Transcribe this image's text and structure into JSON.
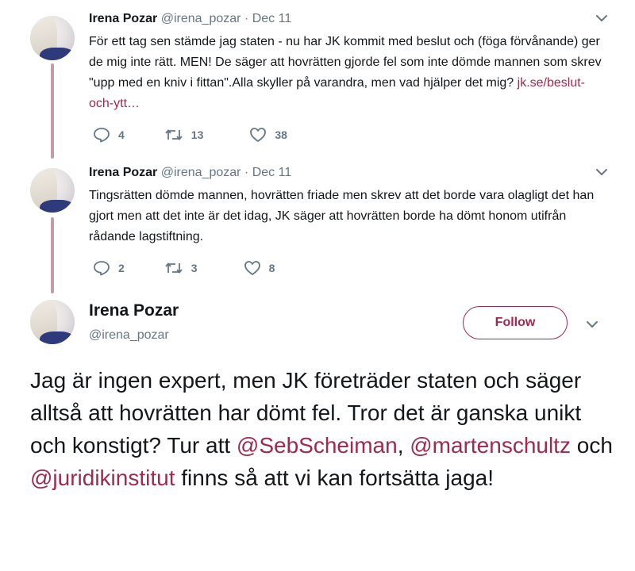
{
  "tweets": [
    {
      "name": "Irena Pozar",
      "handle": "@irena_pozar",
      "separator": "·",
      "date": "Dec 11",
      "text": "För ett tag sen stämde jag staten - nu har JK kommit med beslut och (föga förvånande) ger de mig inte rätt. MEN! De säger att hovrätten gjorde fel som inte dömde mannen som skrev \"upp med en kniv i fittan\".Alla skyller på varandra, men vad hjälper det mig? ",
      "link": "jk.se/beslut-och-ytt…",
      "replies": "4",
      "retweets": "13",
      "likes": "38"
    },
    {
      "name": "Irena Pozar",
      "handle": "@irena_pozar",
      "separator": "·",
      "date": "Dec 11",
      "text": "Tingsrätten dömde mannen, hovrätten friade men skrev att det borde vara olagligt det han gjort men att det inte är det idag, JK säger att hovrätten borde ha dömt honom utifrån rådande lagstiftning.",
      "replies": "2",
      "retweets": "3",
      "likes": "8"
    }
  ],
  "main": {
    "name": "Irena Pozar",
    "handle": "@irena_pozar",
    "follow_label": "Follow",
    "text_parts": [
      "Jag är ingen expert, men JK företräder staten och säger alltså att hovrätten har dömt fel. Tror det är ganska unikt och konstigt? Tur att ",
      "@SebScheiman",
      ", ",
      "@martenschultz",
      " och ",
      "@juridikinstitut",
      " finns så att vi kan fortsätta jaga!"
    ]
  },
  "colors": {
    "accent": "#a0294d",
    "thread_line": "#c79ca6",
    "muted": "#657786"
  },
  "icons": [
    "reply-icon",
    "retweet-icon",
    "like-icon",
    "caret-down-icon"
  ]
}
